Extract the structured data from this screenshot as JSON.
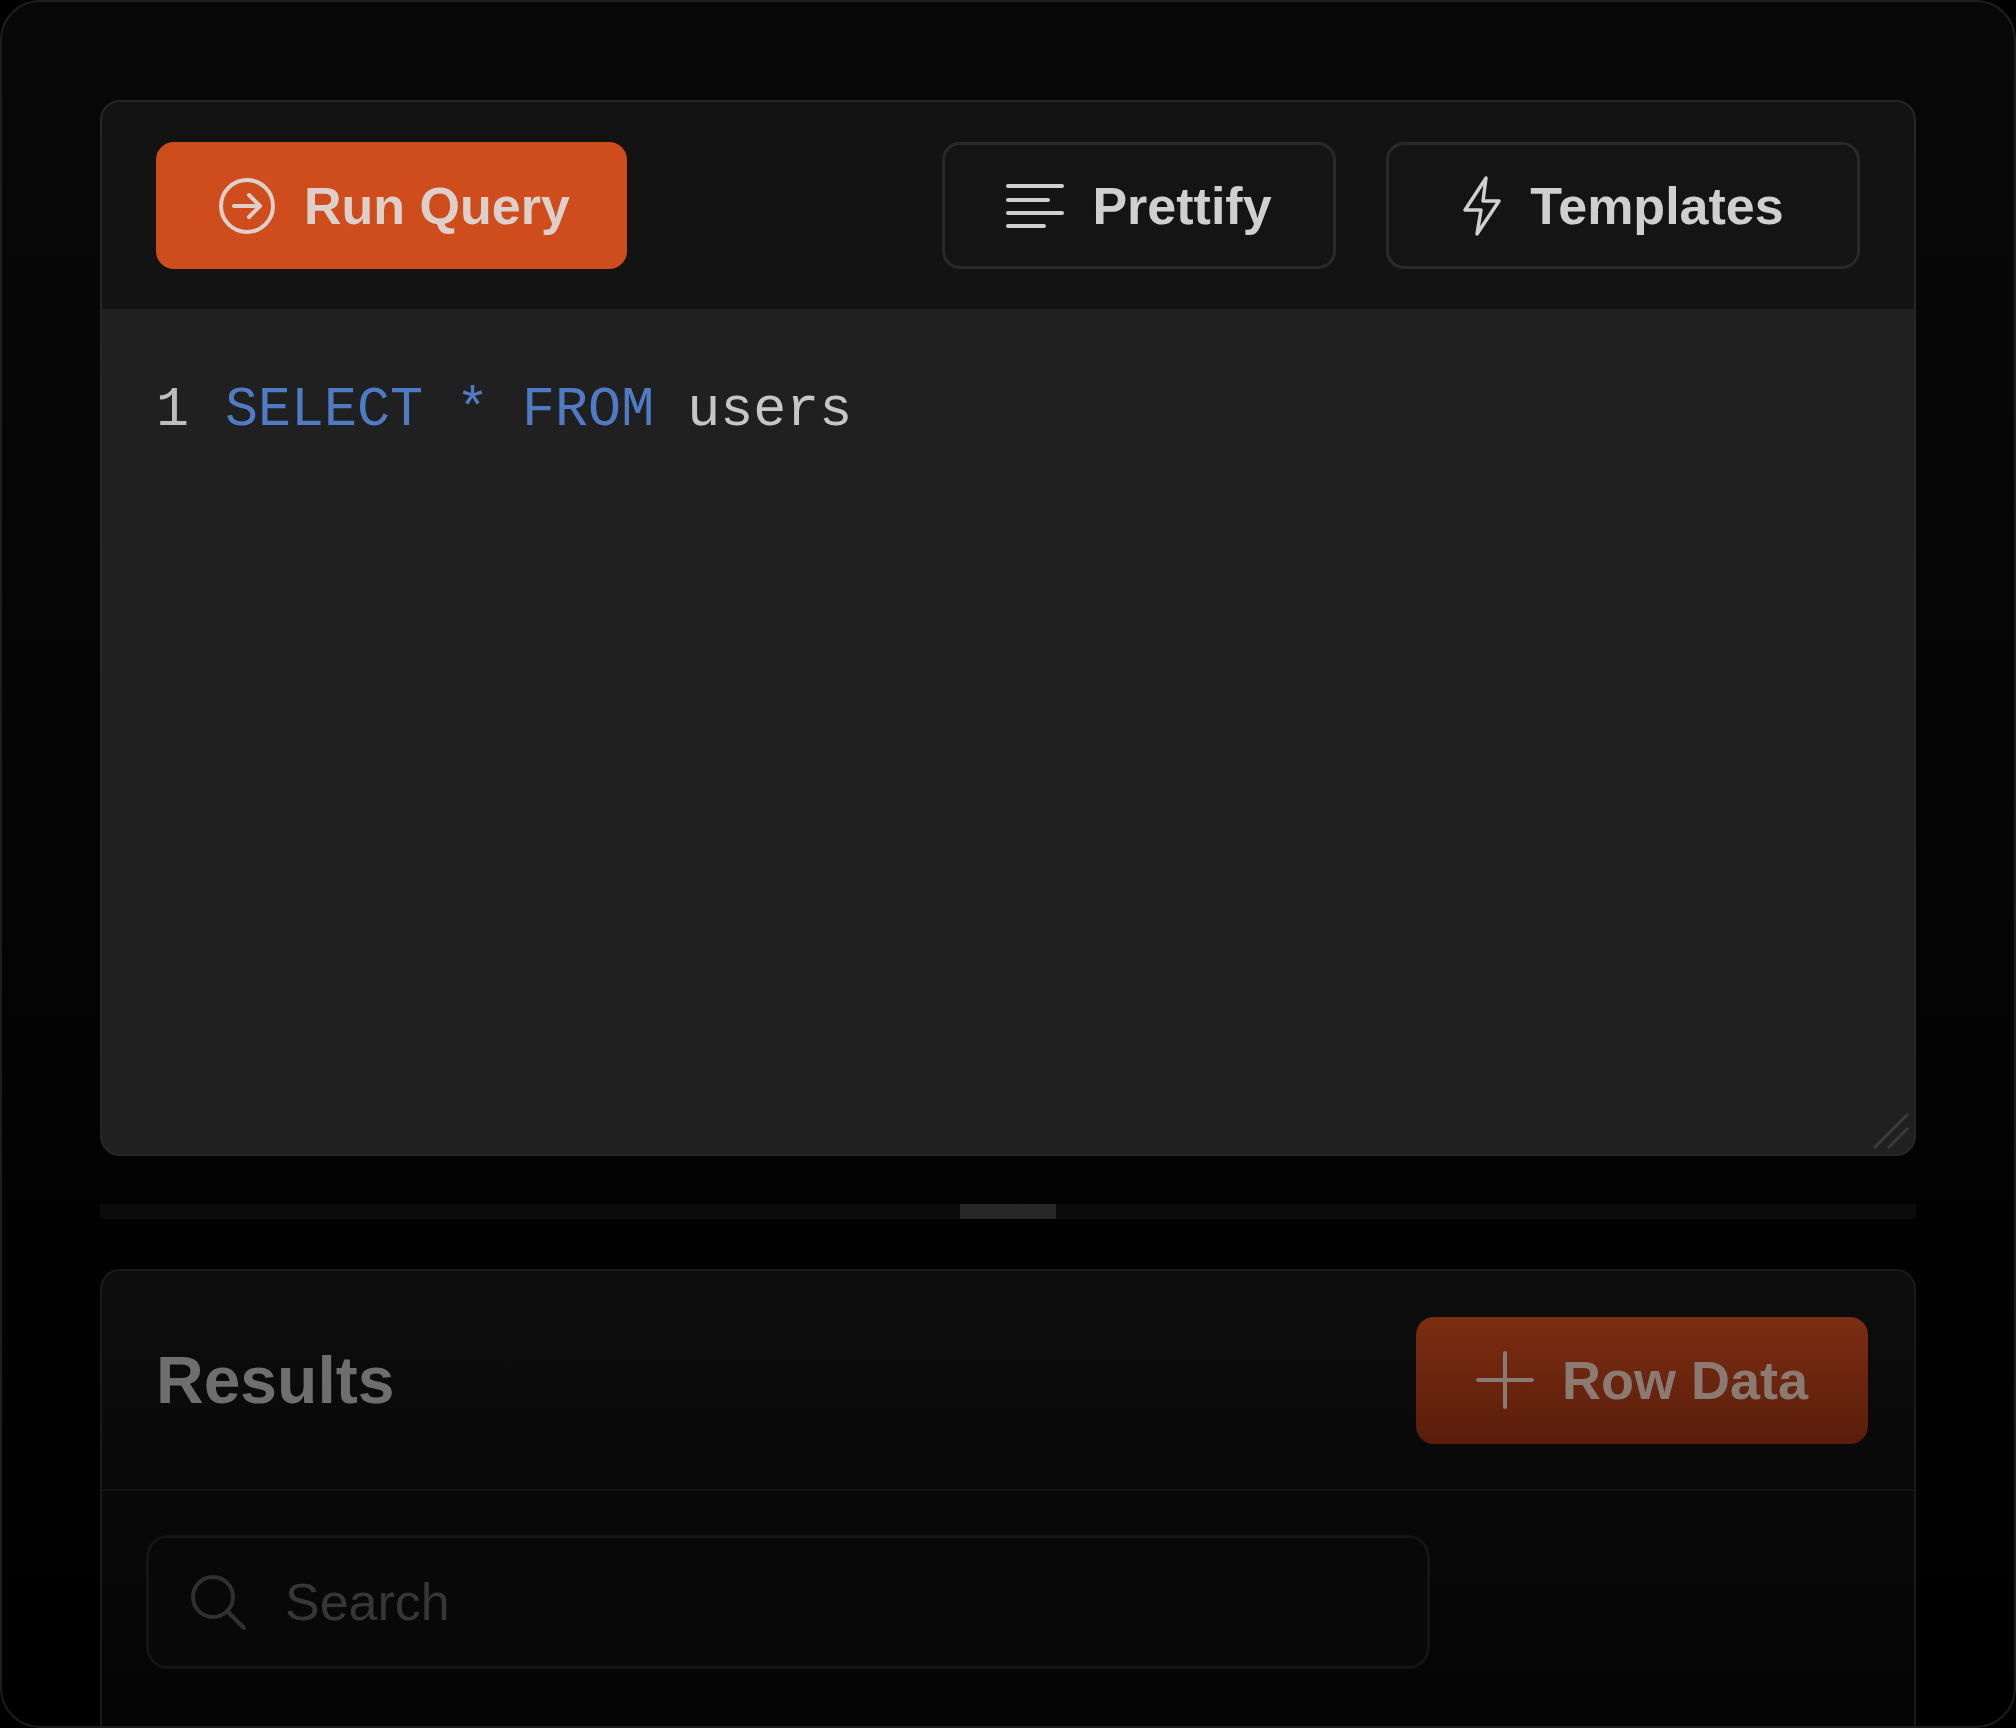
{
  "toolbar": {
    "run_button": "Run Query",
    "prettify_button": "Prettify",
    "templates_button": "Templates"
  },
  "editor": {
    "lines": [
      {
        "number": "1",
        "tokens": [
          {
            "text": "SELECT",
            "kind": "keyword"
          },
          {
            "text": "*",
            "kind": "operator"
          },
          {
            "text": "FROM",
            "kind": "keyword"
          },
          {
            "text": "users",
            "kind": "identifier"
          }
        ]
      }
    ]
  },
  "results": {
    "title": "Results",
    "add_button": "Row Data",
    "search": {
      "placeholder": "Search"
    }
  }
}
